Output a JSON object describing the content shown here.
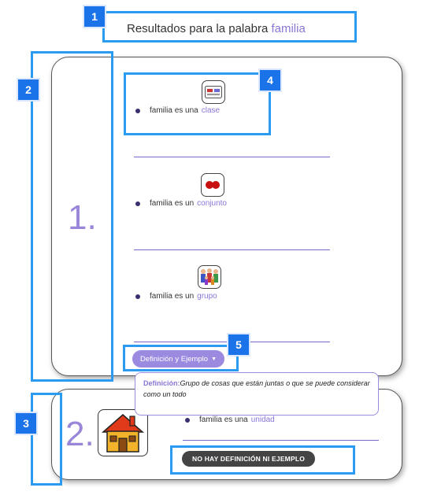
{
  "header": {
    "prefix": "Resultados para la palabra",
    "word": "familia"
  },
  "annotations": [
    "1",
    "2",
    "3",
    "4",
    "5"
  ],
  "results": [
    {
      "rank": "1.",
      "relations": [
        {
          "subject": "familia",
          "verb": "es una",
          "target": "clase",
          "icon": "class-card-icon"
        },
        {
          "subject": "familia",
          "verb": "es un",
          "target": "conjunto",
          "icon": "set-dots-icon"
        },
        {
          "subject": "familia",
          "verb": "es un",
          "target": "grupo",
          "icon": "people-group-icon"
        }
      ],
      "dropdown_label": "Definición y Ejemplo",
      "popover": {
        "label": "Definición:",
        "text": "Grupo de cosas que están juntas o que se puede considerar como un todo"
      }
    },
    {
      "rank": "2.",
      "image_icon": "house-icon",
      "relations": [
        {
          "subject": "familia",
          "verb": "es una",
          "target": "unidad"
        }
      ],
      "status_label": "NO HAY DEFINICIÓN NI EJEMPLO"
    }
  ],
  "colors": {
    "accent": "#8b76d6",
    "annotation": "#2a9bf0",
    "badge": "#1a73e8",
    "button": "#9b8ae0"
  }
}
